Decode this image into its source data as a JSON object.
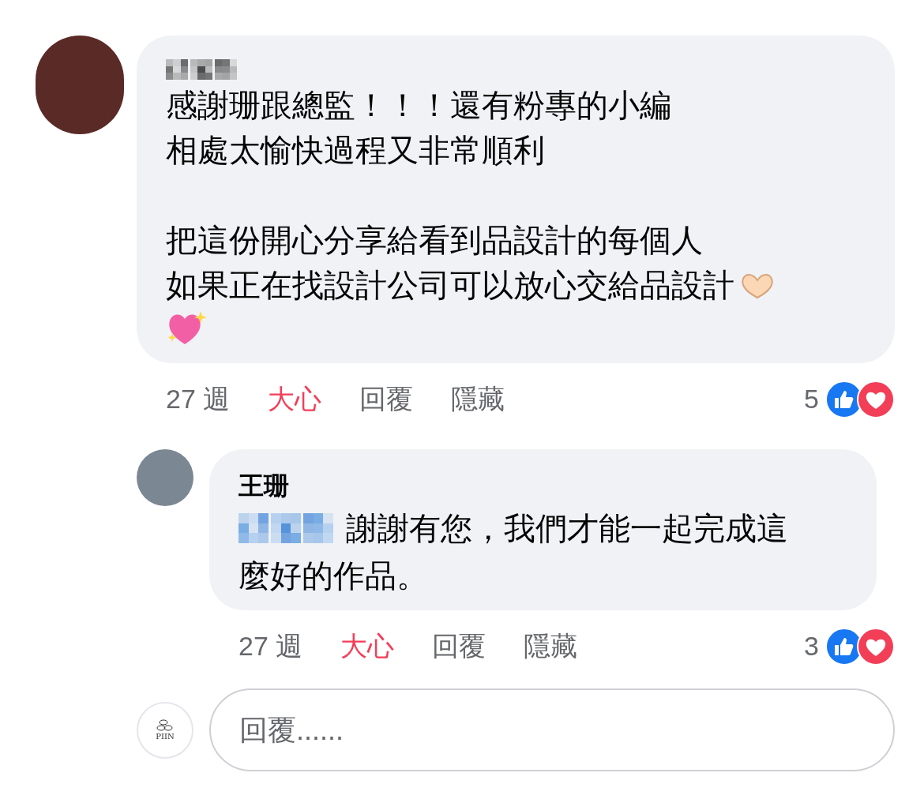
{
  "comments": [
    {
      "paragraphs": [
        [
          "感謝珊跟總監！！！還有粉專的小編",
          "相處太愉快過程又非常順利"
        ],
        [
          "把這份開心分享給看到品設計的每個人",
          "如果正在找設計公司可以放心交給品設計"
        ]
      ],
      "time": "27 週",
      "reaction": {
        "label": "大心",
        "selected": true
      },
      "reply_label": "回覆",
      "hide_label": "隱藏",
      "reaction_count": "5"
    },
    {
      "author": "王珊",
      "lines": [
        "謝謝有您，我們才能一起完成這",
        "麼好的作品。"
      ],
      "time": "27 週",
      "reaction": {
        "label": "大心",
        "selected": true
      },
      "reply_label": "回覆",
      "hide_label": "隱藏",
      "reaction_count": "3"
    }
  ],
  "composer": {
    "avatar_text": "PIIN",
    "placeholder": "回覆......"
  }
}
